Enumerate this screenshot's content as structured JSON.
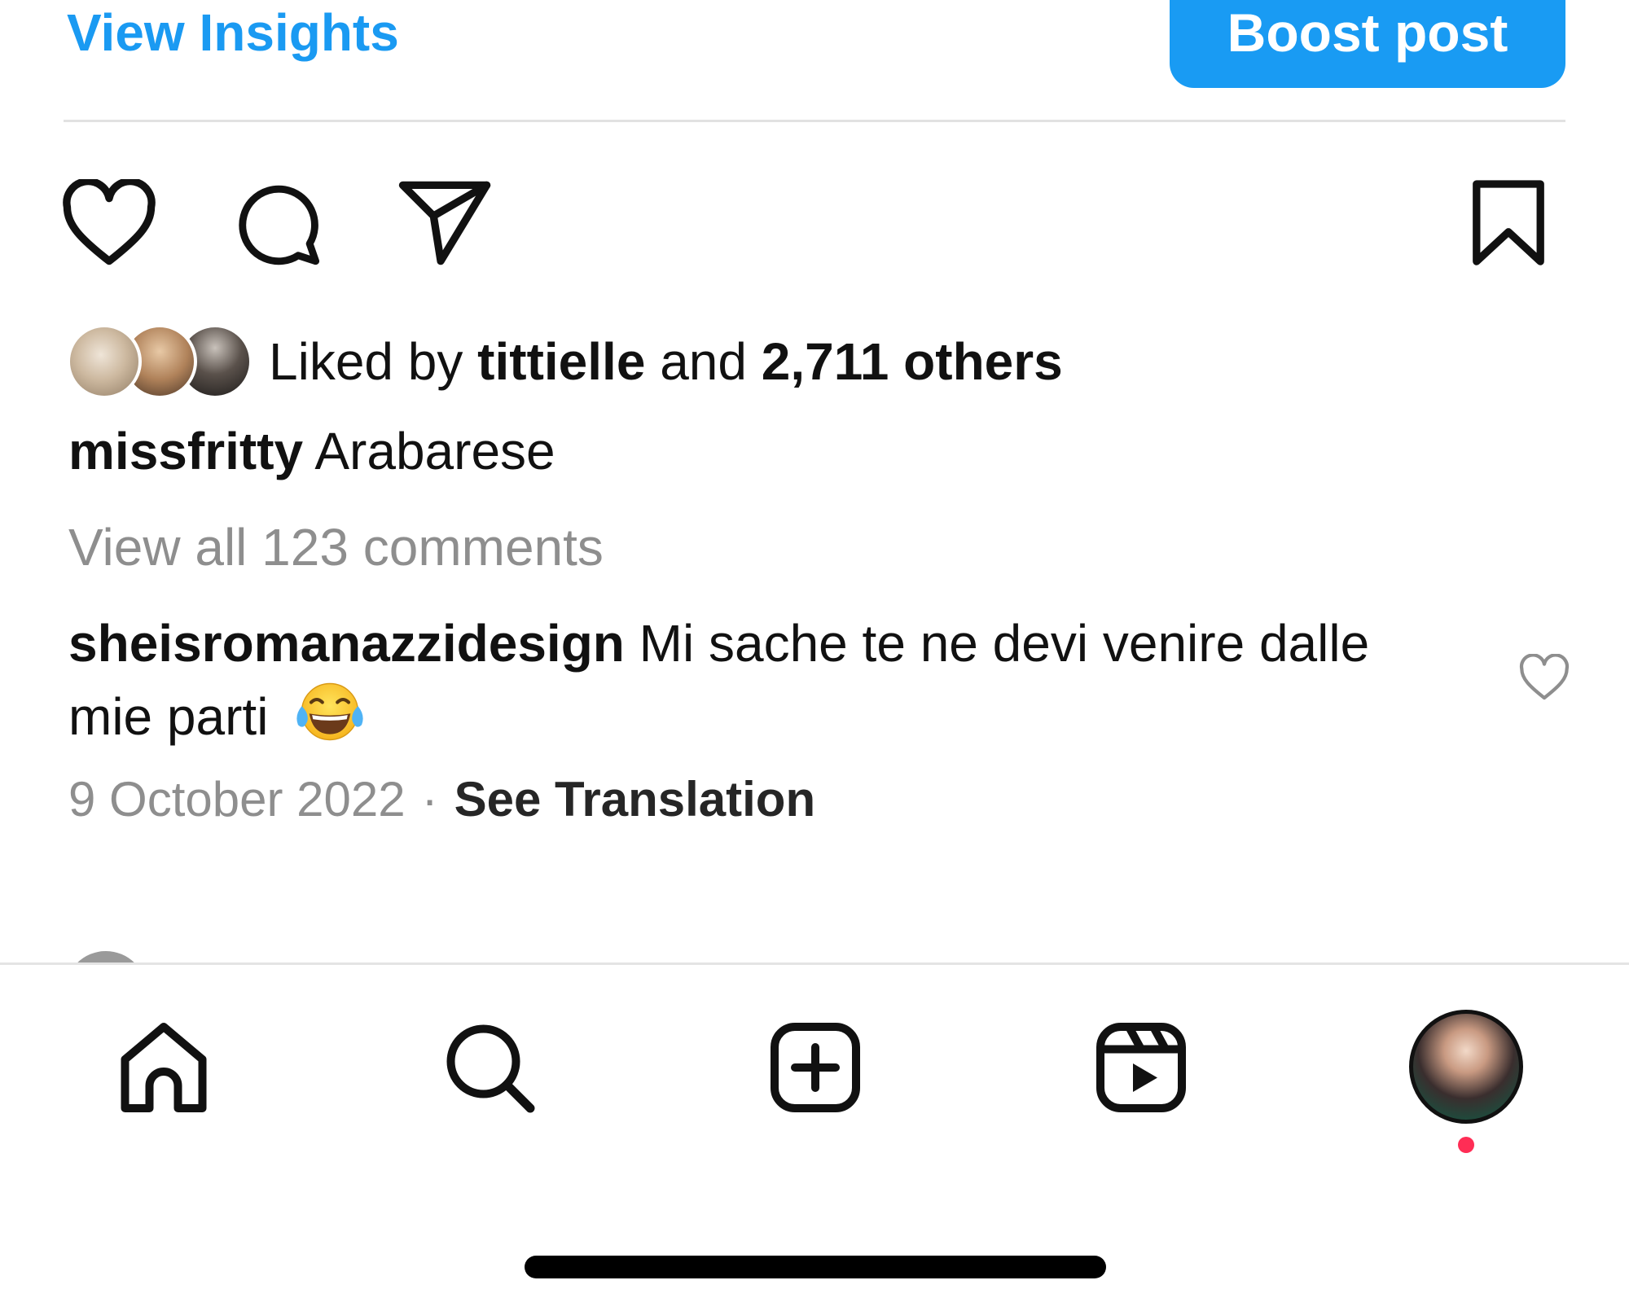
{
  "header": {
    "view_insights_label": "View Insights",
    "boost_post_label": "Boost post"
  },
  "actions": {
    "like_icon": "heart-icon",
    "comment_icon": "comment-icon",
    "share_icon": "paper-plane-icon",
    "save_icon": "bookmark-icon"
  },
  "likes": {
    "prefix": "Liked by ",
    "user": "tittielle",
    "middle": " and ",
    "others": "2,711 others"
  },
  "caption": {
    "username": "missfritty",
    "text": "Arabarese"
  },
  "comments": {
    "view_all_label": "View all 123 comments",
    "top_comment": {
      "username": "sheisromanazzidesign",
      "text": "Mi sache te ne devi venire dalle mie parti",
      "emoji": "face-with-tears-of-joy"
    }
  },
  "meta": {
    "date": "9 October 2022",
    "separator": "·",
    "translation_label": "See Translation"
  },
  "bottom_nav": {
    "items": [
      "home-icon",
      "search-icon",
      "create-icon",
      "reels-icon",
      "profile-avatar"
    ]
  },
  "colors": {
    "accent": "#1a9af2",
    "button_bg": "#199bf3",
    "muted": "#8e8e8e",
    "notification": "#ff2d55"
  }
}
